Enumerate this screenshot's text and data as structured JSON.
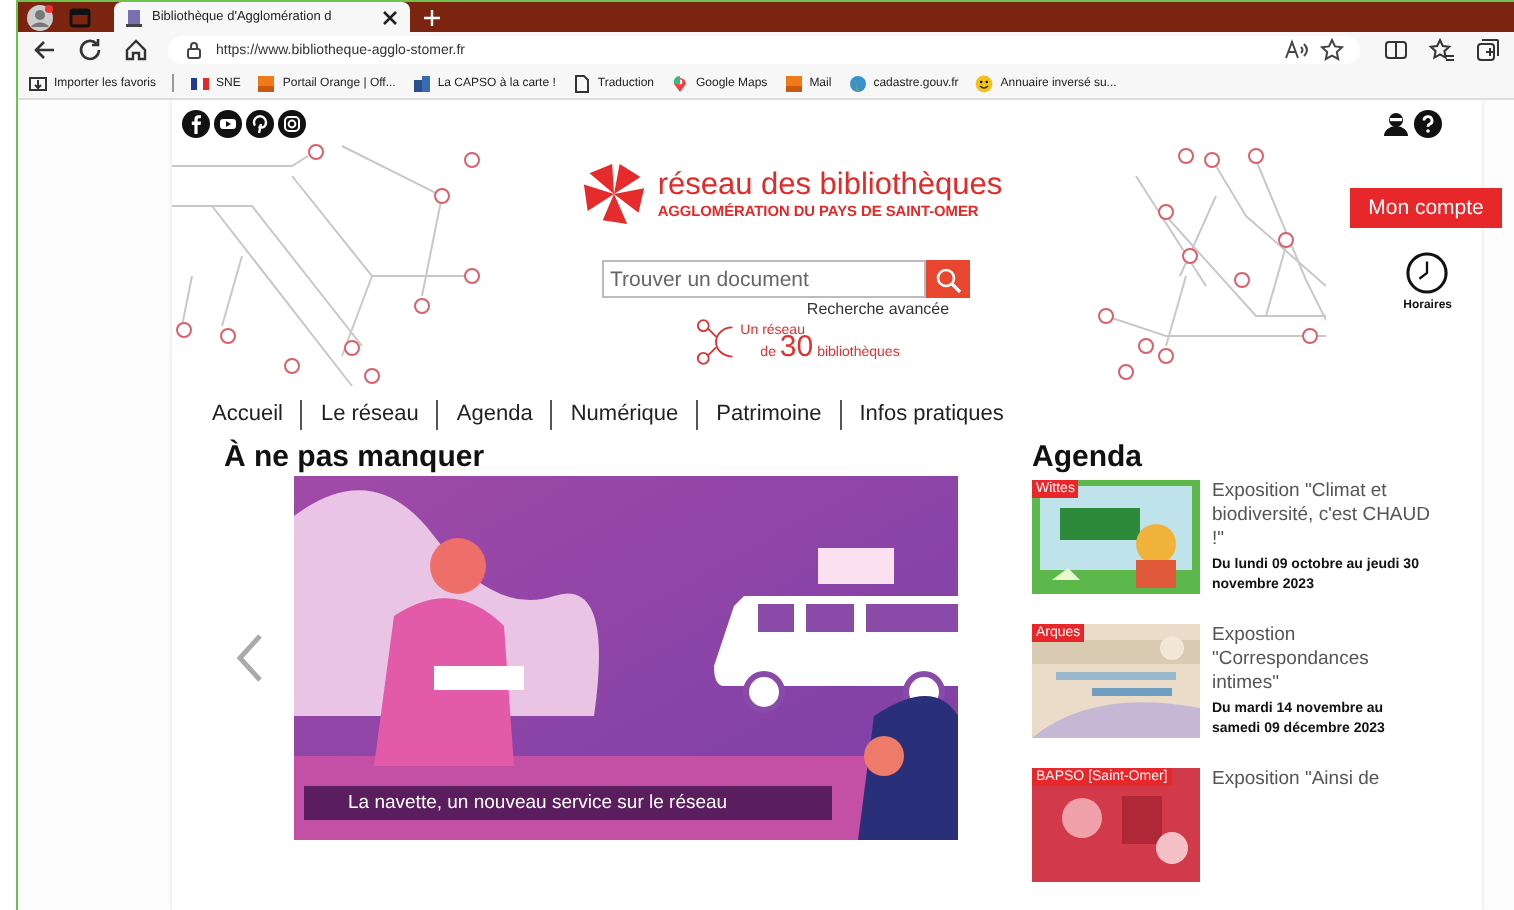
{
  "browser": {
    "tab_title": "Bibliothèque d'Agglomération d",
    "url": "https://www.bibliotheque-agglo-stomer.fr",
    "bookmarks": [
      {
        "label": "Importer les favoris",
        "kind": "import"
      },
      {
        "label": "SNE",
        "kind": "flag"
      },
      {
        "label": "Portail Orange | Off...",
        "kind": "square"
      },
      {
        "label": "La CAPSO à la carte !",
        "kind": "building"
      },
      {
        "label": "Traduction",
        "kind": "page"
      },
      {
        "label": "Google Maps",
        "kind": "pin"
      },
      {
        "label": "Mail",
        "kind": "square"
      },
      {
        "label": "cadastre.gouv.fr",
        "kind": "globe"
      },
      {
        "label": "Annuaire inversé su...",
        "kind": "smiley"
      }
    ]
  },
  "header": {
    "logo_title": "réseau des bibliothèques",
    "logo_subtitle": "AGGLOMÉRATION DU PAYS DE SAINT-OMER",
    "search_placeholder": "Trouver un document",
    "advanced_search": "Recherche avancée",
    "network_prefix": "Un réseau",
    "network_de": "de",
    "network_count": "30",
    "network_suffix": "bibliothèques",
    "account_button": "Mon compte",
    "hours_label": "Horaires"
  },
  "nav": [
    "Accueil",
    "Le réseau",
    "Agenda",
    "Numérique",
    "Patrimoine",
    "Infos pratiques"
  ],
  "featured": {
    "heading": "À ne pas manquer",
    "caption": "La navette, un nouveau service sur le réseau"
  },
  "agenda": {
    "heading": "Agenda",
    "events": [
      {
        "place": "Wittes",
        "title": "Exposition \"Climat et biodiversité, c'est CHAUD !\"",
        "dates": "Du lundi 09 octobre au jeudi 30 novembre 2023"
      },
      {
        "place": "Arques",
        "title": "Expostion \"Correspondances intimes\"",
        "dates": "Du mardi 14 novembre au samedi 09 décembre 2023"
      },
      {
        "place": "BAPSO [Saint-Omer]",
        "title": "Exposition \"Ainsi de"
      }
    ]
  }
}
